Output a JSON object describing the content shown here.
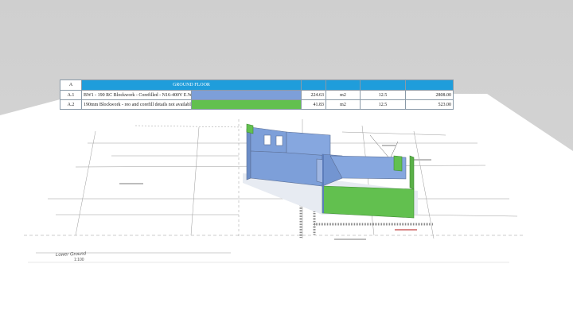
{
  "table": {
    "header": {
      "code": "A",
      "title": "GROUND FLOOR"
    },
    "rows": [
      {
        "code": "A.1",
        "description": "BW1 - 190 RC Blockwork - Corefilled - N16-400V E.W",
        "swatch_color": "#7d9fd9",
        "quantity": "224.63",
        "unit": "m2",
        "rate": "12.5",
        "total": "2808.00"
      },
      {
        "code": "A.2",
        "description": "190mm Blockwork - reo and corefill details not available",
        "swatch_color": "#62c04f",
        "quantity": "41.83",
        "unit": "m2",
        "rate": "12.5",
        "total": "523.00"
      }
    ]
  },
  "drawing": {
    "view_label": "Lower Ground",
    "scale_label": "1:100"
  },
  "colors": {
    "header_blue": "#1f9ddb",
    "wall_blue": "#7d9fd9",
    "wall_green": "#62c04f",
    "sky": "#cfcfcf"
  }
}
